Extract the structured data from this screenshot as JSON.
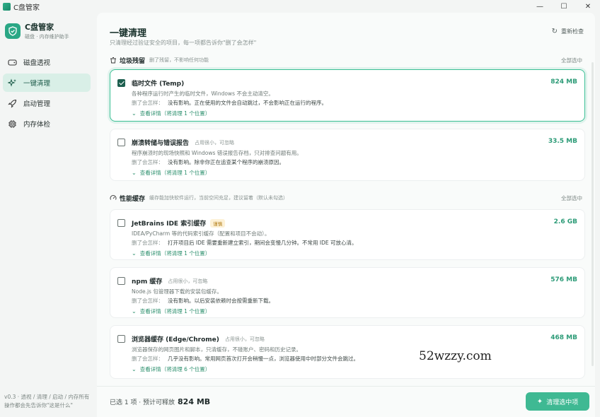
{
  "window": {
    "title": "C盘管家",
    "controls": [
      "—",
      "☐",
      "✕"
    ]
  },
  "brand": {
    "name": "C盘管家",
    "subtitle": "磁盘 · 内存维护助手"
  },
  "sidebar": {
    "items": [
      {
        "label": "磁盘透视",
        "icon": "disk-icon",
        "active": false
      },
      {
        "label": "一键清理",
        "icon": "sparkle-icon",
        "active": true
      },
      {
        "label": "启动管理",
        "icon": "rocket-icon",
        "active": false
      },
      {
        "label": "内存体检",
        "icon": "chip-icon",
        "active": false
      }
    ],
    "footer": "v0.3 · 透视 / 清理 / 启动 / 内存所有操作都会先告诉你\"这是什么\""
  },
  "main": {
    "title": "一键清理",
    "subtitle": "只清理经过验证安全的项目，每一项都告诉你\"删了会怎样\"",
    "recheck_label": "重新检查"
  },
  "sections": [
    {
      "title": "垃圾残留",
      "desc": "删了残留，不影响任何功能",
      "select_all": "全部选中",
      "icon": "trash-icon"
    },
    {
      "title": "性能缓存",
      "desc": "缓存能加快软件运行，当前空间充足，建议留着（默认未勾选）",
      "select_all": "全部选中",
      "icon": "gauge-icon"
    }
  ],
  "impact_label": "删了会怎样：",
  "items": [
    {
      "name": "临时文件 (Temp)",
      "tag": "",
      "badge": "",
      "size": "824 MB",
      "checked": true,
      "desc": "各种程序运行时产生的临时文件，Windows 不会主动清空。",
      "impact": "没有影响。正在使用的文件会自动跳过，不会影响正在运行的程序。",
      "detail": "查看详情（将清理 1 个位置）"
    },
    {
      "name": "崩溃转储与错误报告",
      "tag": "占用很小，可忽略",
      "badge": "",
      "size": "33.5 MB",
      "checked": false,
      "desc": "程序崩溃时的现场快照和 Windows 错误报告存档，只对排查问题有用。",
      "impact": "没有影响。除非你正在追查某个程序的崩溃原因。",
      "detail": "查看详情（将清理 1 个位置）"
    },
    {
      "name": "JetBrains IDE 索引缓存",
      "tag": "",
      "badge": "谨慎",
      "size": "2.6 GB",
      "checked": false,
      "desc": "IDEA/PyCharm 等的代码索引缓存（配置和项目不会动）。",
      "impact": "打开项目后 IDE 需要重新建立索引，期间会变慢几分钟。不常用 IDE 可放心清。",
      "detail": "查看详情（将清理 1 个位置）"
    },
    {
      "name": "npm 缓存",
      "tag": "占用很小，可忽略",
      "badge": "",
      "size": "576 MB",
      "checked": false,
      "desc": "Node.js 包管理器下载的安装包缓存。",
      "impact": "没有影响。以后安装依赖时会按需重新下载。",
      "detail": "查看详情（将清理 1 个位置）"
    },
    {
      "name": "浏览器缓存 (Edge/Chrome)",
      "tag": "占用很小，可忽略",
      "badge": "",
      "size": "468 MB",
      "checked": false,
      "desc": "浏览器保存的网页图片和脚本，只清缓存，不碰账户、密码和历史记录。",
      "impact": "几乎没有影响。常用网页首次打开会稍慢一点，浏览器使用中时部分文件会跳过。",
      "detail": "查看详情（将清理 6 个位置）"
    }
  ],
  "footer": {
    "summary_prefix": "已选 1 项 · 预计可释放",
    "summary_value": "824 MB",
    "clean_label": "清理选中项"
  },
  "watermark": "52wzzy.com",
  "colors": {
    "accent": "#3fb993",
    "size_text": "#2c9b77",
    "selected_border": "#3bbf94",
    "nav_active_bg": "#d9efe7"
  }
}
